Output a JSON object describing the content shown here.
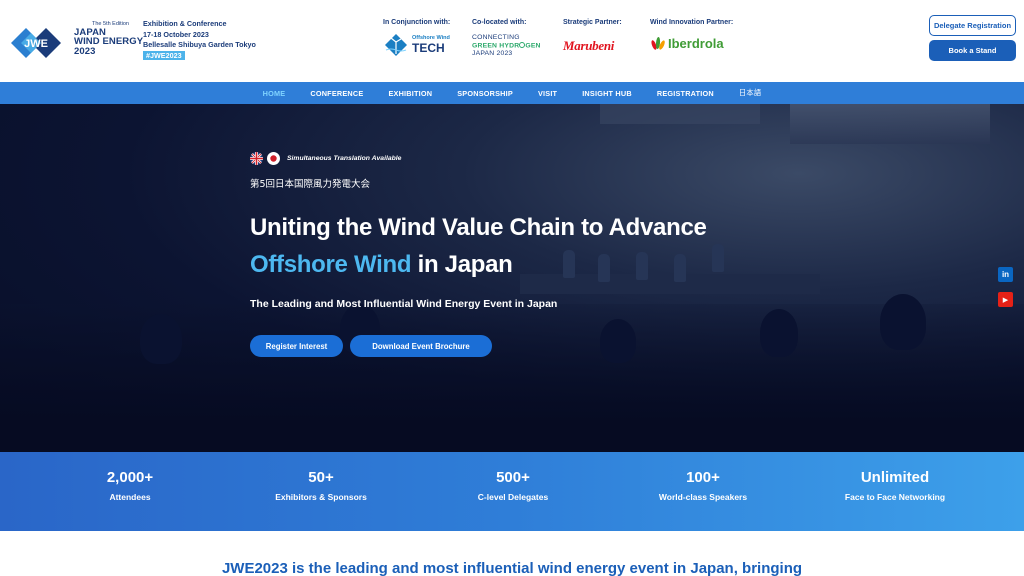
{
  "header": {
    "logo": {
      "mark": "JWE",
      "edition": "The 5th Edition",
      "line1": "JAPAN",
      "line2": "WIND ENERGY",
      "line3": "2023"
    },
    "event": {
      "type": "Exhibition & Conference",
      "dates": "17-18 October 2023",
      "venue": "Bellesalle Shibuya Garden Tokyo",
      "hashtag": "#JWE2023"
    },
    "partners": [
      {
        "role": "In Conjunction with:",
        "logo_small": "Offshore Wind",
        "logo_big": "TECH"
      },
      {
        "role": "Co-located with:",
        "line1": "CONNECTING",
        "line2a": "GREEN HYDR",
        "line2b": "GEN",
        "line3": "JAPAN 2023"
      },
      {
        "role": "Strategic Partner:",
        "logo": "Marubeni"
      },
      {
        "role": "Wind Innovation Partner:",
        "logo": "Iberdrola"
      }
    ],
    "buttons": {
      "delegate": "Delegate Registration",
      "stand": "Book a Stand"
    }
  },
  "nav": {
    "items": [
      "HOME",
      "CONFERENCE",
      "EXHIBITION",
      "SPONSORSHIP",
      "VISIT",
      "INSIGHT HUB",
      "REGISTRATION",
      "日本語"
    ],
    "active": "HOME"
  },
  "hero": {
    "translation": "Simultaneous Translation Available",
    "jp_title": "第5回日本国際風力発電大会",
    "headline_1": "Uniting the Wind Value Chain to Advance",
    "headline_accent": "Offshore Wind",
    "headline_2": " in Japan",
    "subtitle": "The Leading and Most Influential Wind Energy Event in Japan",
    "btn_register": "Register Interest",
    "btn_brochure": "Download Event Brochure"
  },
  "social": {
    "linkedin": "in",
    "youtube": "▶"
  },
  "stats": [
    {
      "num": "2,000+",
      "label": "Attendees"
    },
    {
      "num": "50+",
      "label": "Exhibitors & Sponsors"
    },
    {
      "num": "500+",
      "label": "C-level Delegates"
    },
    {
      "num": "100+",
      "label": "World-class Speakers"
    },
    {
      "num": "Unlimited",
      "label": "Face to Face Networking"
    }
  ],
  "intro": {
    "text": "JWE2023 is the leading and most influential wind energy event in Japan, bringing"
  },
  "colors": {
    "brand": "#1b5fb8",
    "nav": "#2f7ed8",
    "accent": "#4db8f0",
    "nav_active": "#7fd3ff",
    "marubeni": "#e1141f",
    "iberdrola": "#3f9c35"
  }
}
